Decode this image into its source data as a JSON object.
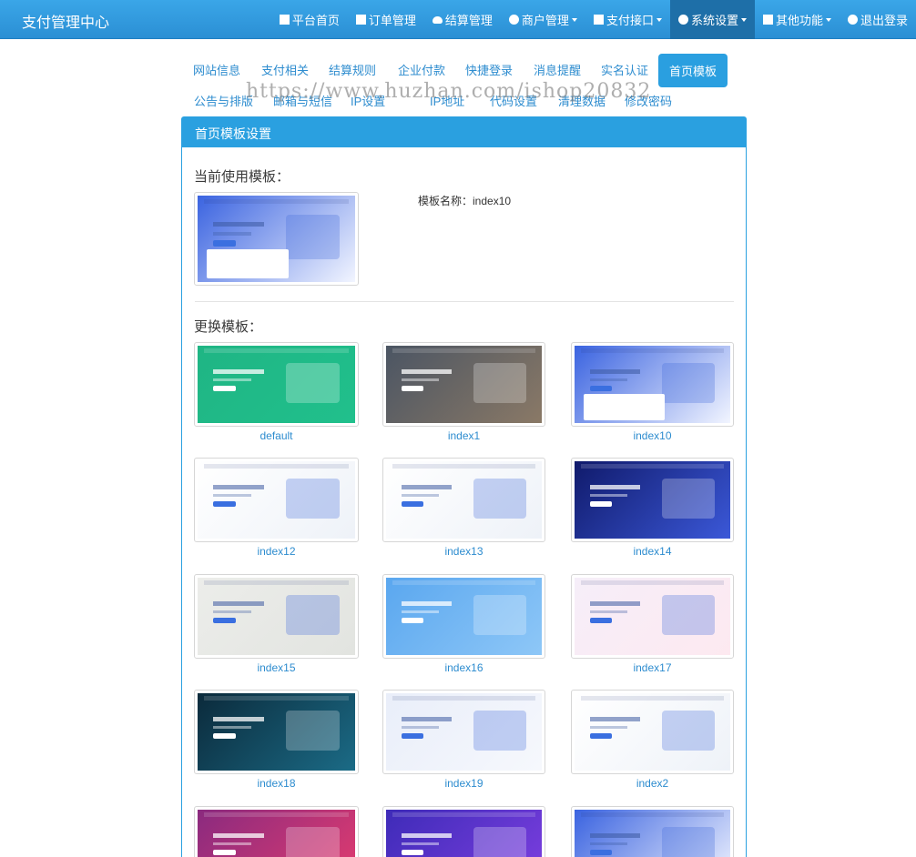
{
  "app": {
    "brand": "支付管理中心"
  },
  "nav": [
    {
      "label": "平台首页",
      "icon": "home-icon",
      "caret": false,
      "active": false
    },
    {
      "label": "订单管理",
      "icon": "list-icon",
      "caret": false,
      "active": false
    },
    {
      "label": "结算管理",
      "icon": "cloud-icon",
      "caret": false,
      "active": false
    },
    {
      "label": "商户管理",
      "icon": "user-icon",
      "caret": true,
      "active": false
    },
    {
      "label": "支付接口",
      "icon": "card-icon",
      "caret": true,
      "active": false
    },
    {
      "label": "系统设置",
      "icon": "gear-icon",
      "caret": true,
      "active": true
    },
    {
      "label": "其他功能",
      "icon": "cube-icon",
      "caret": true,
      "active": false
    },
    {
      "label": "退出登录",
      "icon": "power-icon",
      "caret": false,
      "active": false
    }
  ],
  "tabs": [
    {
      "label": "网站信息",
      "active": false
    },
    {
      "label": "支付相关",
      "active": false
    },
    {
      "label": "结算规则",
      "active": false
    },
    {
      "label": "企业付款",
      "active": false
    },
    {
      "label": "快捷登录",
      "active": false
    },
    {
      "label": "消息提醒",
      "active": false
    },
    {
      "label": "实名认证",
      "active": false
    },
    {
      "label": "首页模板",
      "active": true
    },
    {
      "label": "公告与排版",
      "active": false
    },
    {
      "label": "邮箱与短信",
      "active": false
    },
    {
      "label": "IP设置",
      "active": false
    },
    {
      "label": "IP地址",
      "active": false
    },
    {
      "label": "代码设置",
      "active": false
    },
    {
      "label": "清理数据",
      "active": false
    },
    {
      "label": "修改密码",
      "active": false
    }
  ],
  "watermark": "https://www.huzhan.com/ishop20832",
  "panel": {
    "title": "首页模板设置",
    "current_title": "当前使用模板：",
    "current_name": "模板名称：index10",
    "change_title": "更换模板："
  },
  "templates": [
    {
      "name": "default",
      "theme": "green"
    },
    {
      "name": "index1",
      "theme": "city"
    },
    {
      "name": "index10",
      "theme": "blue"
    },
    {
      "name": "index12",
      "theme": "white"
    },
    {
      "name": "index13",
      "theme": "white"
    },
    {
      "name": "index14",
      "theme": "navy"
    },
    {
      "name": "index15",
      "theme": "grey"
    },
    {
      "name": "index16",
      "theme": "sky"
    },
    {
      "name": "index17",
      "theme": "pink"
    },
    {
      "name": "index18",
      "theme": "ocean"
    },
    {
      "name": "index19",
      "theme": "light"
    },
    {
      "name": "index2",
      "theme": "white"
    },
    {
      "name": "",
      "theme": "magenta"
    },
    {
      "name": "",
      "theme": "purple"
    },
    {
      "name": "",
      "theme": "blue"
    }
  ],
  "colors": {
    "navbar": "#2b8fd4",
    "accent": "#2aa0e0",
    "link": "#2d8ccf"
  }
}
